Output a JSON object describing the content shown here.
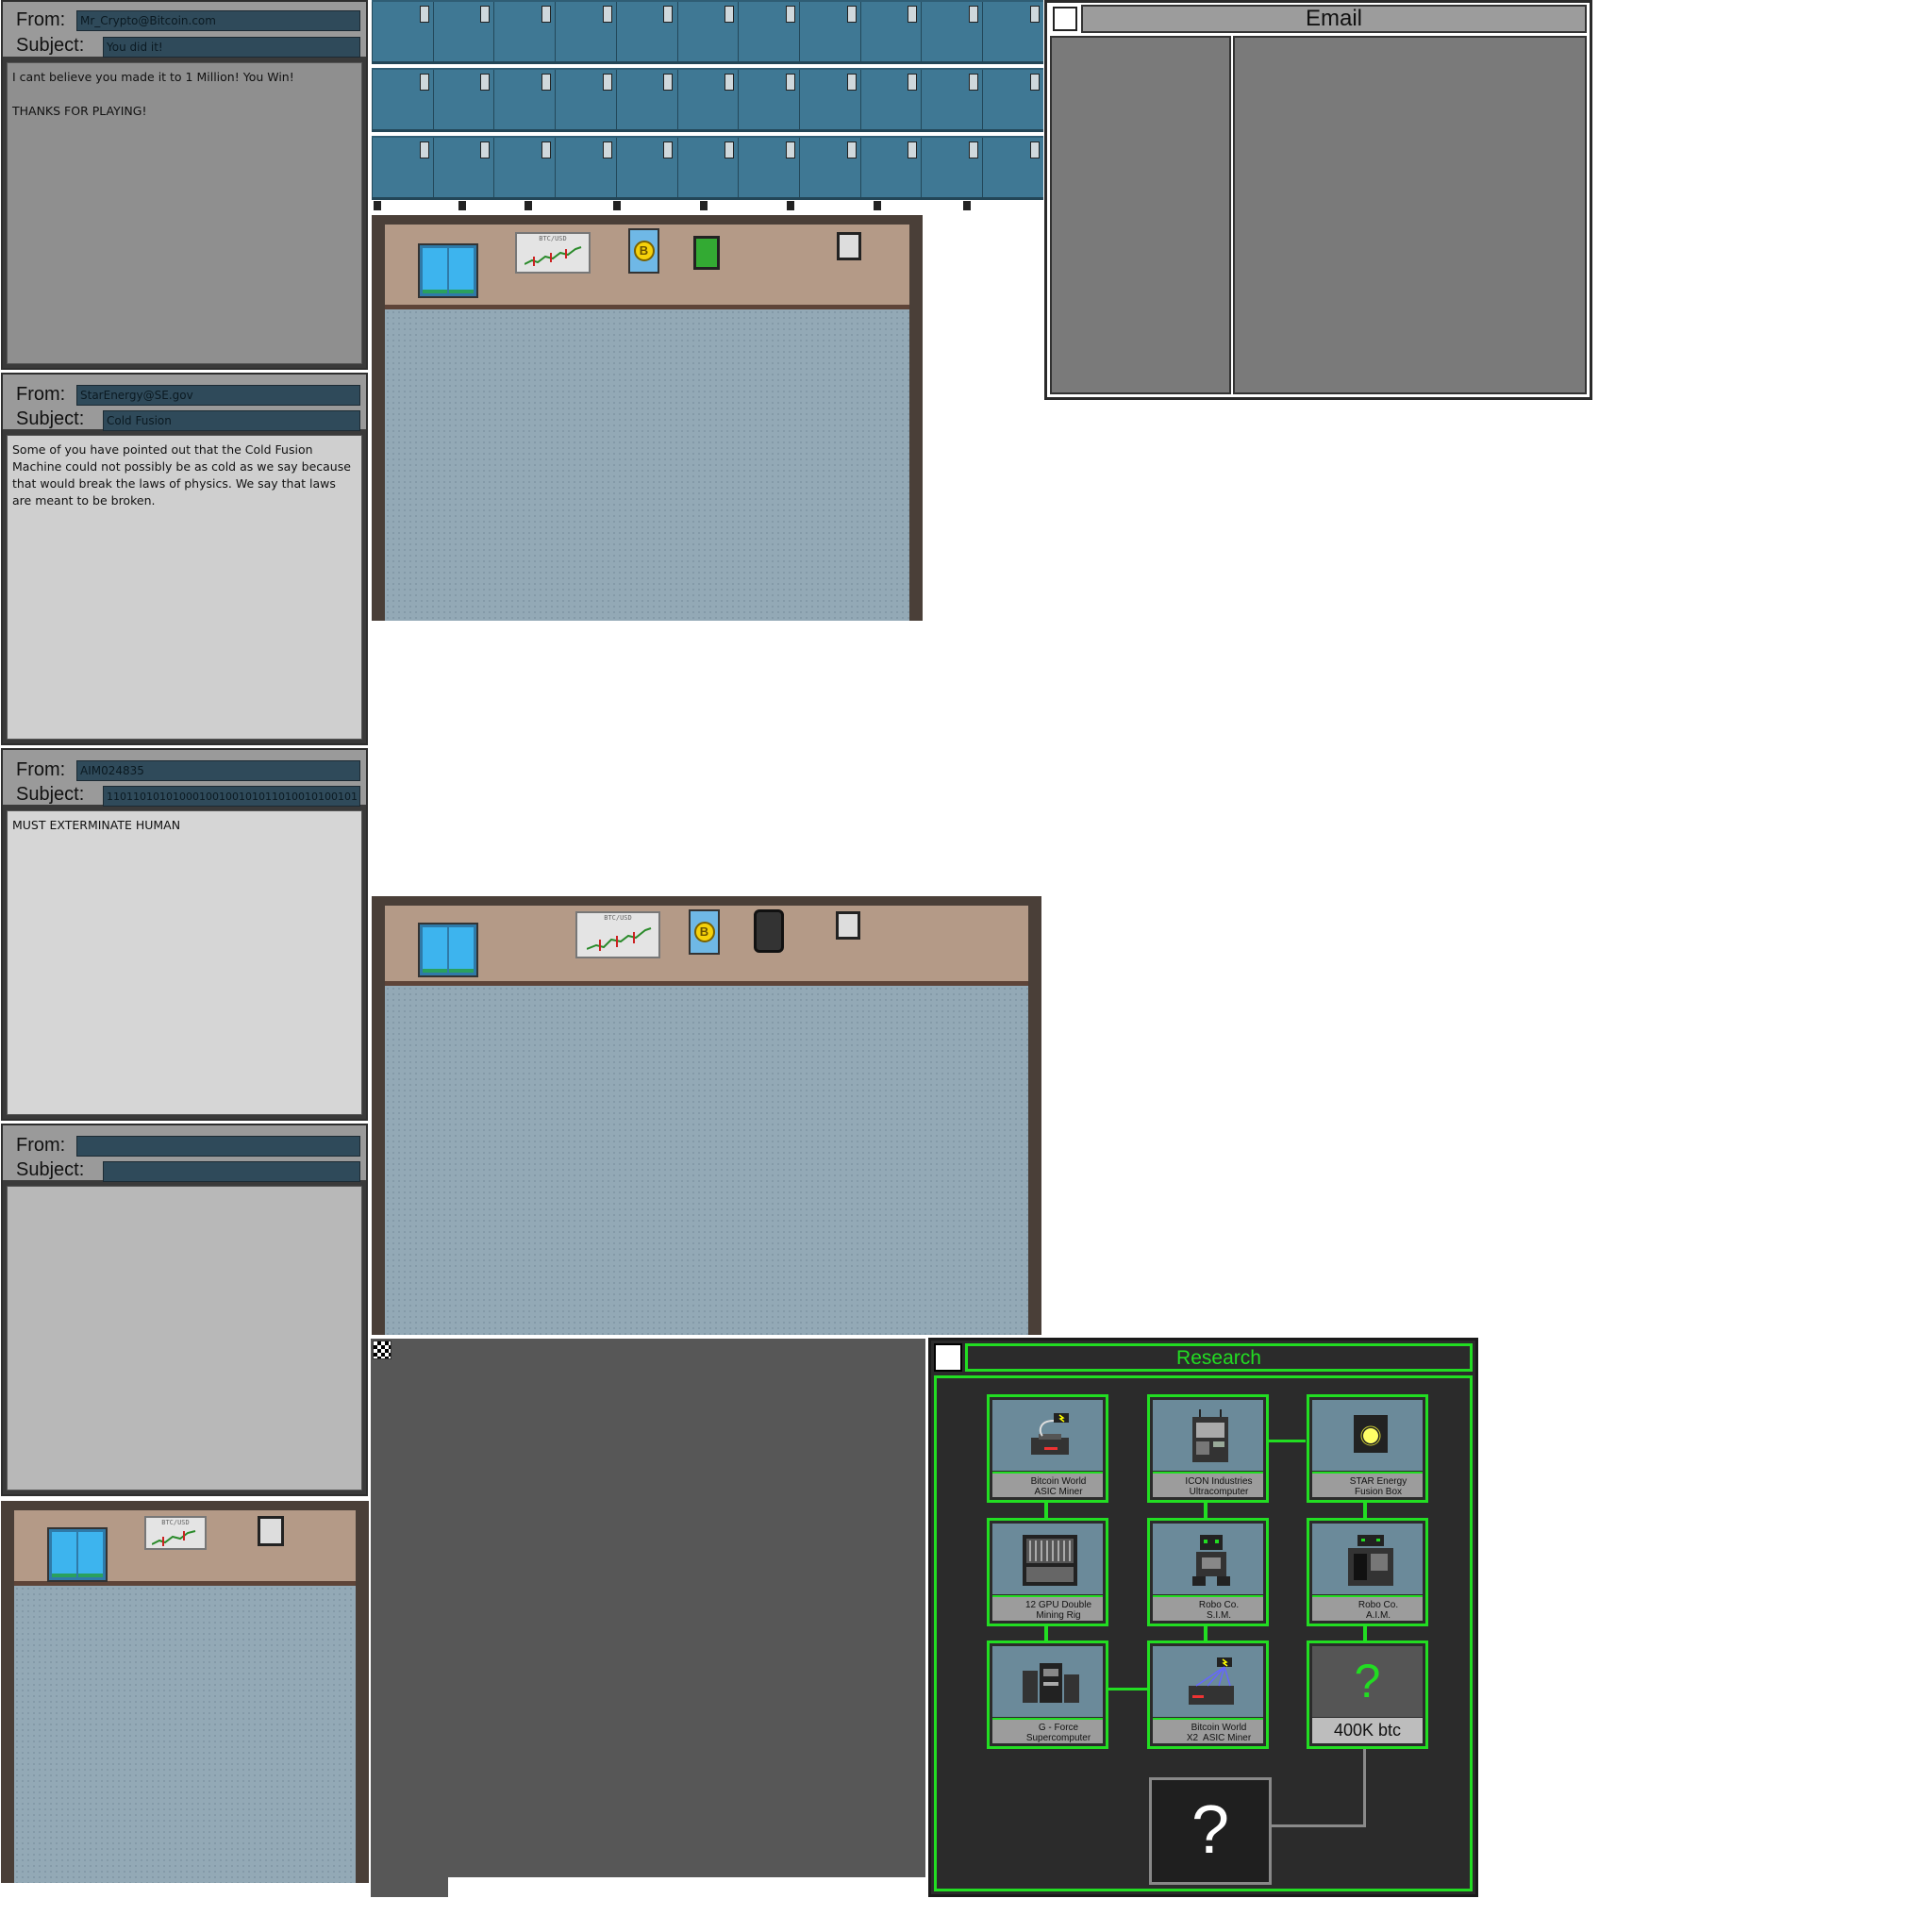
{
  "emails": [
    {
      "from_label": "From:",
      "subject_label": "Subject:",
      "from": "Mr_Crypto@Bitcoin.com",
      "subject": "You did it!",
      "body": "I cant believe you made it to 1 Million! You Win!\n\nTHANKS FOR PLAYING!",
      "body_color": "#8f8f8f"
    },
    {
      "from_label": "From:",
      "subject_label": "Subject:",
      "from": "StarEnergy@SE.gov",
      "subject": "Cold Fusion",
      "body": "Some of you have pointed out that the Cold Fusion Machine could not possibly be as cold as we say because that would break the laws of physics. We say that laws are meant to be broken.",
      "body_color": "#cfcfcf"
    },
    {
      "from_label": "From:",
      "subject_label": "Subject:",
      "from": "AIM024835",
      "subject": "11011010101000100100101011010010100101",
      "body": "MUST EXTERMINATE HUMAN",
      "body_color": "#d6d6d6"
    },
    {
      "from_label": "From:",
      "subject_label": "Subject:",
      "from": "",
      "subject": "",
      "body": "",
      "body_color": "#b8b8b8"
    }
  ],
  "rooms": {
    "chart_title": "BTC/USD"
  },
  "email_window": {
    "title": "Email"
  },
  "research": {
    "title": "Research",
    "nodes": [
      {
        "label": "Bitcoin World\nASIC Miner",
        "logo": "globe-icon"
      },
      {
        "label": "ICON Industries\nUltracomputer",
        "logo": "chip-icon"
      },
      {
        "label": "STAR Energy\nFusion Box",
        "logo": "star-icon"
      },
      {
        "label": "12 GPU Double\nMining Rig",
        "logo": "signal-bars-icon"
      },
      {
        "label": "Robo Co.\nS.I.M.",
        "logo": "robot-logo-icon"
      },
      {
        "label": "Robo Co.\nA.I.M.",
        "logo": "robot-logo-icon"
      },
      {
        "label": "G - Force\nSupercomputer",
        "logo": "triangle-icon"
      },
      {
        "label": "Bitcoin World\nX2  ASIC Miner",
        "logo": "globe-icon"
      }
    ],
    "unknown_node": {
      "symbol": "?",
      "cost": "400K btc"
    },
    "locked_node": {
      "symbol": "?"
    }
  },
  "colors": {
    "accent_green": "#22dd22",
    "field_dark": "#2f4a5a",
    "cabinet_blue": "#3f7894",
    "wall_tan": "#b49a87",
    "floor_blue": "#93a9b6"
  }
}
